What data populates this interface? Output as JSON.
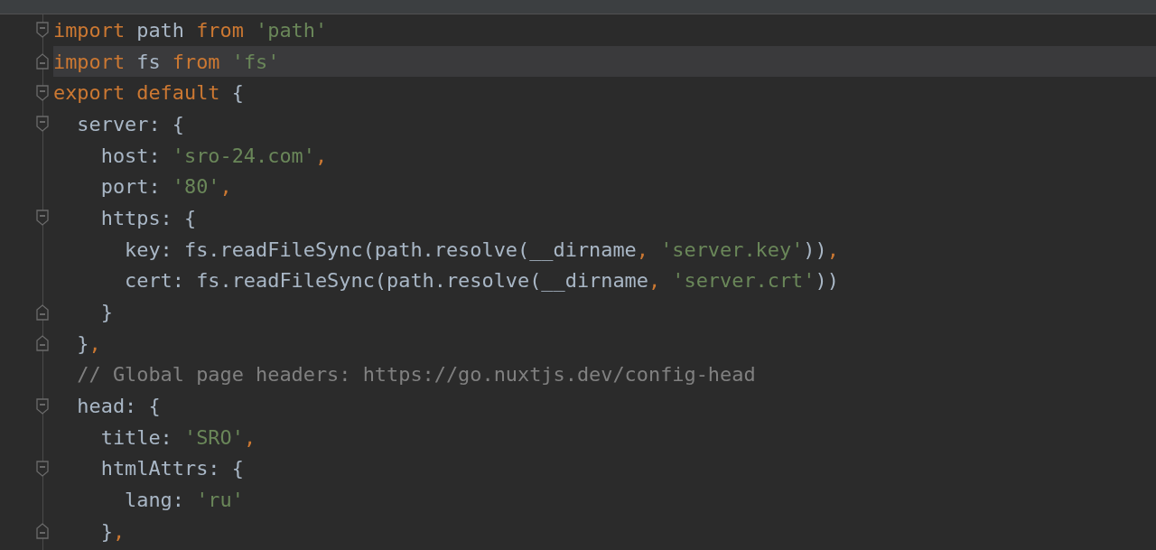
{
  "editor": {
    "lines": [
      {
        "kind": "fold-start",
        "current": false,
        "tokens": [
          {
            "kind": "keyword",
            "text": "import "
          },
          {
            "kind": "plain",
            "text": "path "
          },
          {
            "kind": "keyword",
            "text": "from "
          },
          {
            "kind": "string",
            "text": "'path'"
          }
        ]
      },
      {
        "kind": "fold-end",
        "current": true,
        "tokens": [
          {
            "kind": "keyword",
            "text": "import "
          },
          {
            "kind": "plain",
            "text": "fs "
          },
          {
            "kind": "keyword",
            "text": "from "
          },
          {
            "kind": "string",
            "text": "'fs'"
          }
        ]
      },
      {
        "kind": "fold-start",
        "current": false,
        "tokens": [
          {
            "kind": "keyword",
            "text": "export default"
          },
          {
            "kind": "plain",
            "text": " {"
          }
        ]
      },
      {
        "kind": "fold-start",
        "current": false,
        "tokens": [
          {
            "kind": "plain",
            "text": "  server: {"
          }
        ]
      },
      {
        "kind": "plain",
        "current": false,
        "tokens": [
          {
            "kind": "plain",
            "text": "    host: "
          },
          {
            "kind": "string",
            "text": "'sro-24.com'"
          },
          {
            "kind": "keyword",
            "text": ","
          }
        ]
      },
      {
        "kind": "plain",
        "current": false,
        "tokens": [
          {
            "kind": "plain",
            "text": "    port: "
          },
          {
            "kind": "string",
            "text": "'80'"
          },
          {
            "kind": "keyword",
            "text": ","
          }
        ]
      },
      {
        "kind": "fold-start",
        "current": false,
        "tokens": [
          {
            "kind": "plain",
            "text": "    https: {"
          }
        ]
      },
      {
        "kind": "plain",
        "current": false,
        "tokens": [
          {
            "kind": "plain",
            "text": "      key: fs.readFileSync(path.resolve(__dirname"
          },
          {
            "kind": "keyword",
            "text": ", "
          },
          {
            "kind": "string",
            "text": "'server.key'"
          },
          {
            "kind": "plain",
            "text": "))"
          },
          {
            "kind": "keyword",
            "text": ","
          }
        ]
      },
      {
        "kind": "plain",
        "current": false,
        "tokens": [
          {
            "kind": "plain",
            "text": "      cert: fs.readFileSync(path.resolve(__dirname"
          },
          {
            "kind": "keyword",
            "text": ", "
          },
          {
            "kind": "string",
            "text": "'server.crt'"
          },
          {
            "kind": "plain",
            "text": "))"
          }
        ]
      },
      {
        "kind": "fold-end",
        "current": false,
        "tokens": [
          {
            "kind": "plain",
            "text": "    }"
          }
        ]
      },
      {
        "kind": "fold-end",
        "current": false,
        "tokens": [
          {
            "kind": "plain",
            "text": "  }"
          },
          {
            "kind": "keyword",
            "text": ","
          }
        ]
      },
      {
        "kind": "plain",
        "current": false,
        "tokens": [
          {
            "kind": "comment",
            "text": "  // Global page headers: https://go.nuxtjs.dev/config-head"
          }
        ]
      },
      {
        "kind": "fold-start",
        "current": false,
        "tokens": [
          {
            "kind": "plain",
            "text": "  head: {"
          }
        ]
      },
      {
        "kind": "plain",
        "current": false,
        "tokens": [
          {
            "kind": "plain",
            "text": "    title: "
          },
          {
            "kind": "string",
            "text": "'SRO'"
          },
          {
            "kind": "keyword",
            "text": ","
          }
        ]
      },
      {
        "kind": "fold-start",
        "current": false,
        "tokens": [
          {
            "kind": "plain",
            "text": "    htmlAttrs: {"
          }
        ]
      },
      {
        "kind": "plain",
        "current": false,
        "tokens": [
          {
            "kind": "plain",
            "text": "      lang: "
          },
          {
            "kind": "string",
            "text": "'ru'"
          }
        ]
      },
      {
        "kind": "fold-end",
        "current": false,
        "tokens": [
          {
            "kind": "plain",
            "text": "    }"
          },
          {
            "kind": "keyword",
            "text": ","
          }
        ]
      }
    ]
  }
}
